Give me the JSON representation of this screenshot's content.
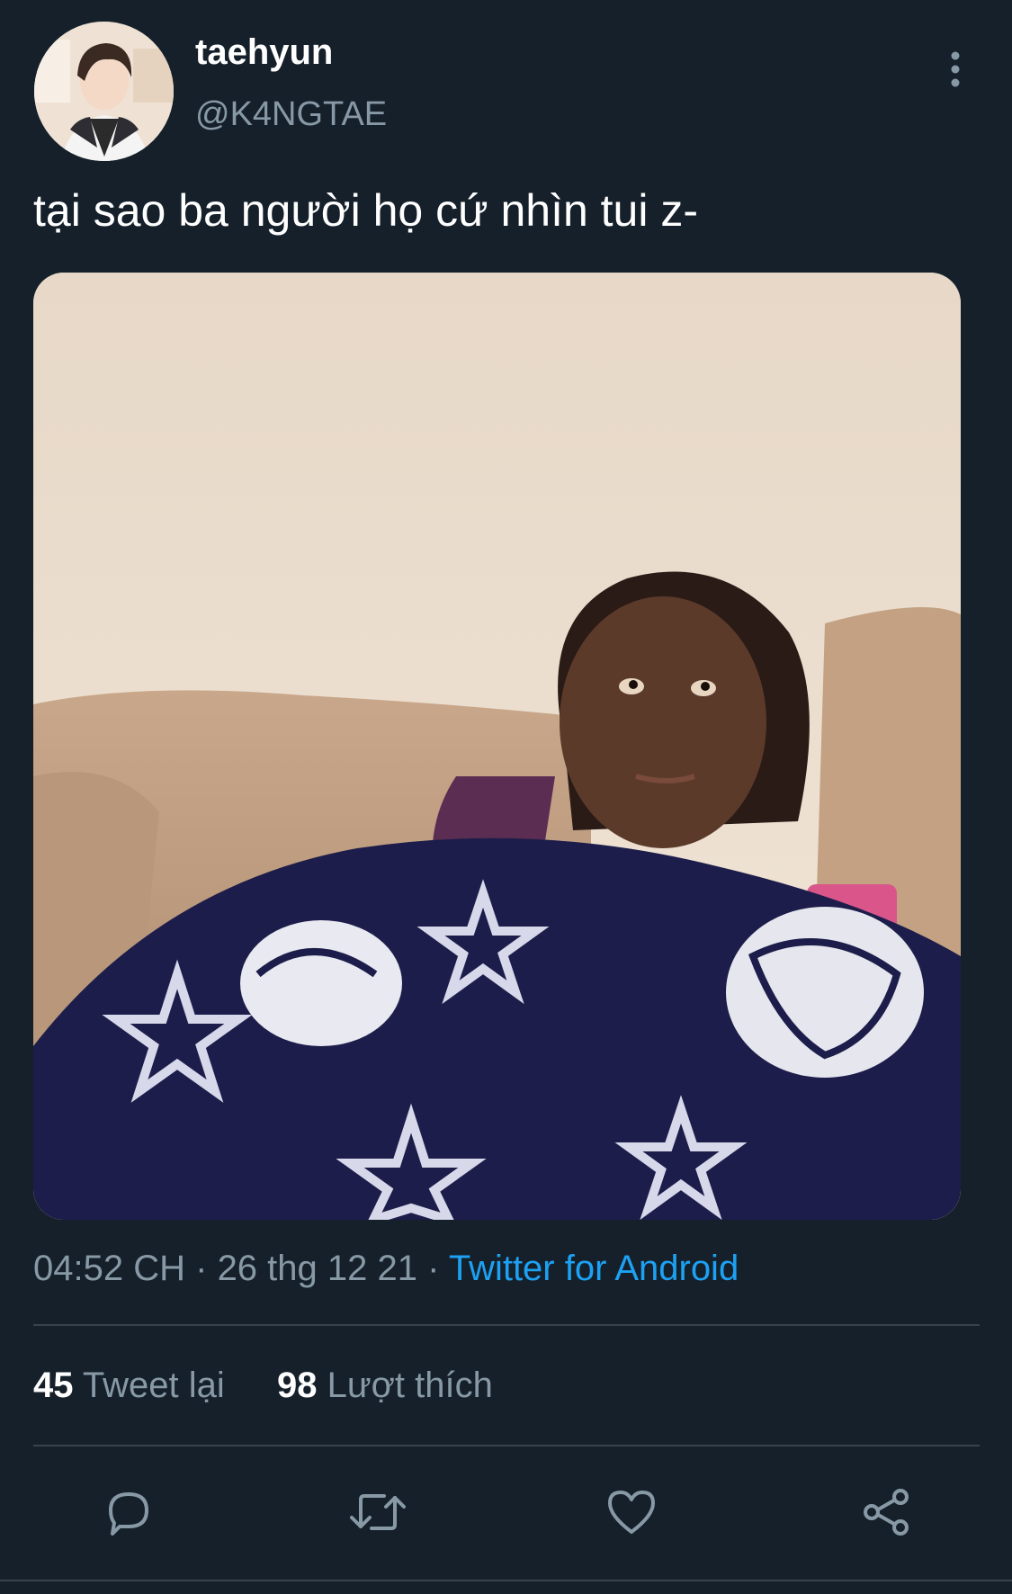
{
  "author": {
    "name": "taehyun",
    "handle": "@K4NGTAE"
  },
  "tweet": {
    "text": "tại sao ba người họ cứ nhìn tui z-",
    "time": "04:52 CH",
    "date": "26 thg 12 21",
    "separator": "·",
    "source": "Twitter for Android"
  },
  "stats": {
    "retweets_count": "45",
    "retweets_label": "Tweet lại",
    "likes_count": "98",
    "likes_label": "Lượt thích"
  },
  "actions": [
    "reply-icon",
    "retweet-icon",
    "like-icon",
    "share-icon"
  ],
  "colors": {
    "background": "#15202b",
    "primary_text": "#ffffff",
    "secondary_text": "#8899a6",
    "link": "#1da1f2",
    "divider": "#38444d"
  }
}
